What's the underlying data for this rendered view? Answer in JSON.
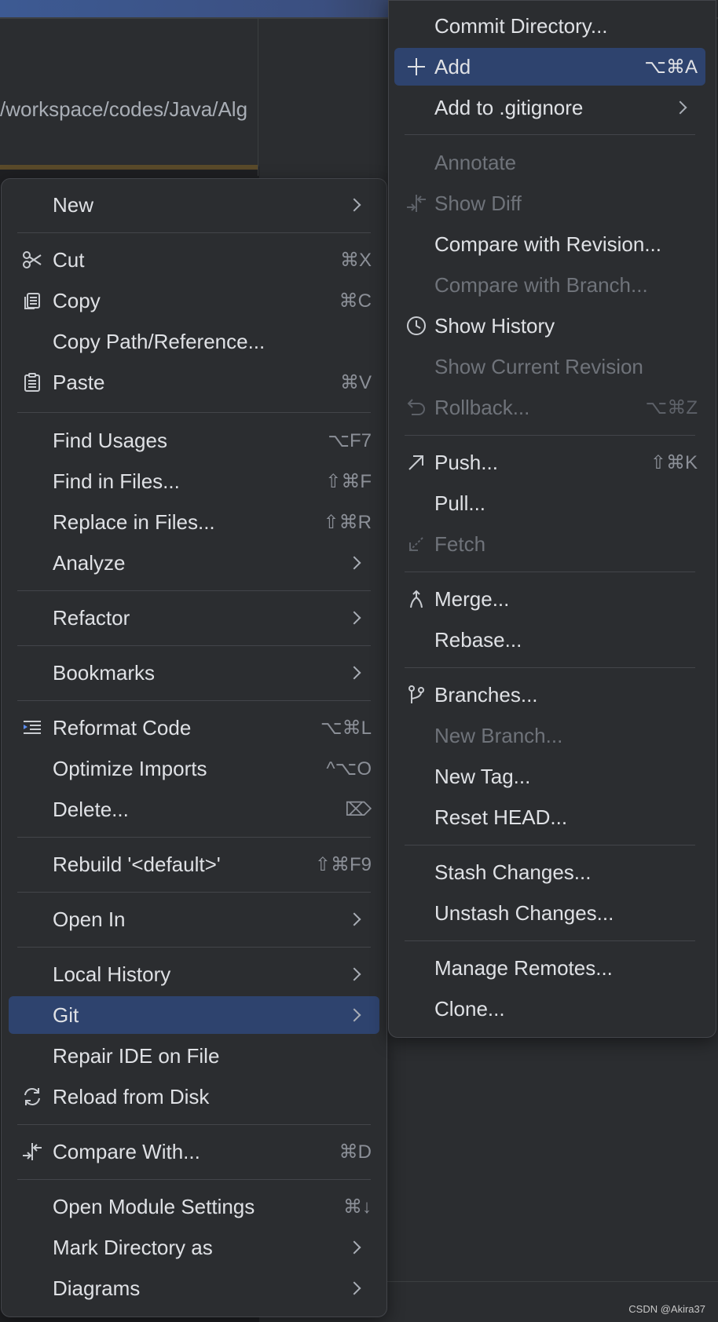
{
  "editor": {
    "path_text": "/workspace/codes/Java/Alg"
  },
  "watermark": "CSDN @Akira37",
  "context_menu": {
    "new": {
      "label": "New"
    },
    "cut": {
      "label": "Cut",
      "shortcut": "⌘X"
    },
    "copy": {
      "label": "Copy",
      "shortcut": "⌘C"
    },
    "copy_path": {
      "label": "Copy Path/Reference..."
    },
    "paste": {
      "label": "Paste",
      "shortcut": "⌘V"
    },
    "find_usages": {
      "label": "Find Usages",
      "shortcut": "⌥F7"
    },
    "find_in_files": {
      "label": "Find in Files...",
      "shortcut": "⇧⌘F"
    },
    "replace_in_files": {
      "label": "Replace in Files...",
      "shortcut": "⇧⌘R"
    },
    "analyze": {
      "label": "Analyze"
    },
    "refactor": {
      "label": "Refactor"
    },
    "bookmarks": {
      "label": "Bookmarks"
    },
    "reformat_code": {
      "label": "Reformat Code",
      "shortcut": "⌥⌘L"
    },
    "optimize_imports": {
      "label": "Optimize Imports",
      "shortcut": "^⌥O"
    },
    "delete": {
      "label": "Delete...",
      "shortcut": "⌦"
    },
    "rebuild": {
      "label": "Rebuild '<default>'",
      "shortcut": "⇧⌘F9"
    },
    "open_in": {
      "label": "Open In"
    },
    "local_history": {
      "label": "Local History"
    },
    "git": {
      "label": "Git"
    },
    "repair_ide": {
      "label": "Repair IDE on File"
    },
    "reload_from_disk": {
      "label": "Reload from Disk"
    },
    "compare_with": {
      "label": "Compare With...",
      "shortcut": "⌘D"
    },
    "open_module_settings": {
      "label": "Open Module Settings",
      "shortcut": "⌘↓"
    },
    "mark_directory_as": {
      "label": "Mark Directory as"
    },
    "diagrams": {
      "label": "Diagrams"
    }
  },
  "git_menu": {
    "commit_directory": {
      "label": "Commit Directory..."
    },
    "add": {
      "label": "Add",
      "shortcut": "⌥⌘A"
    },
    "add_to_gitignore": {
      "label": "Add to .gitignore"
    },
    "annotate": {
      "label": "Annotate"
    },
    "show_diff": {
      "label": "Show Diff"
    },
    "compare_with_revision": {
      "label": "Compare with Revision..."
    },
    "compare_with_branch": {
      "label": "Compare with Branch..."
    },
    "show_history": {
      "label": "Show History"
    },
    "show_current_revision": {
      "label": "Show Current Revision"
    },
    "rollback": {
      "label": "Rollback...",
      "shortcut": "⌥⌘Z"
    },
    "push": {
      "label": "Push...",
      "shortcut": "⇧⌘K"
    },
    "pull": {
      "label": "Pull..."
    },
    "fetch": {
      "label": "Fetch"
    },
    "merge": {
      "label": "Merge..."
    },
    "rebase": {
      "label": "Rebase..."
    },
    "branches": {
      "label": "Branches..."
    },
    "new_branch": {
      "label": "New Branch..."
    },
    "new_tag": {
      "label": "New Tag..."
    },
    "reset_head": {
      "label": "Reset HEAD..."
    },
    "stash_changes": {
      "label": "Stash Changes..."
    },
    "unstash_changes": {
      "label": "Unstash Changes..."
    },
    "manage_remotes": {
      "label": "Manage Remotes..."
    },
    "clone": {
      "label": "Clone..."
    }
  },
  "colors": {
    "menu_bg": "#2b2d30",
    "selection": "#2e436e",
    "text": "#dfe1e5",
    "disabled_text": "#6f737a"
  }
}
